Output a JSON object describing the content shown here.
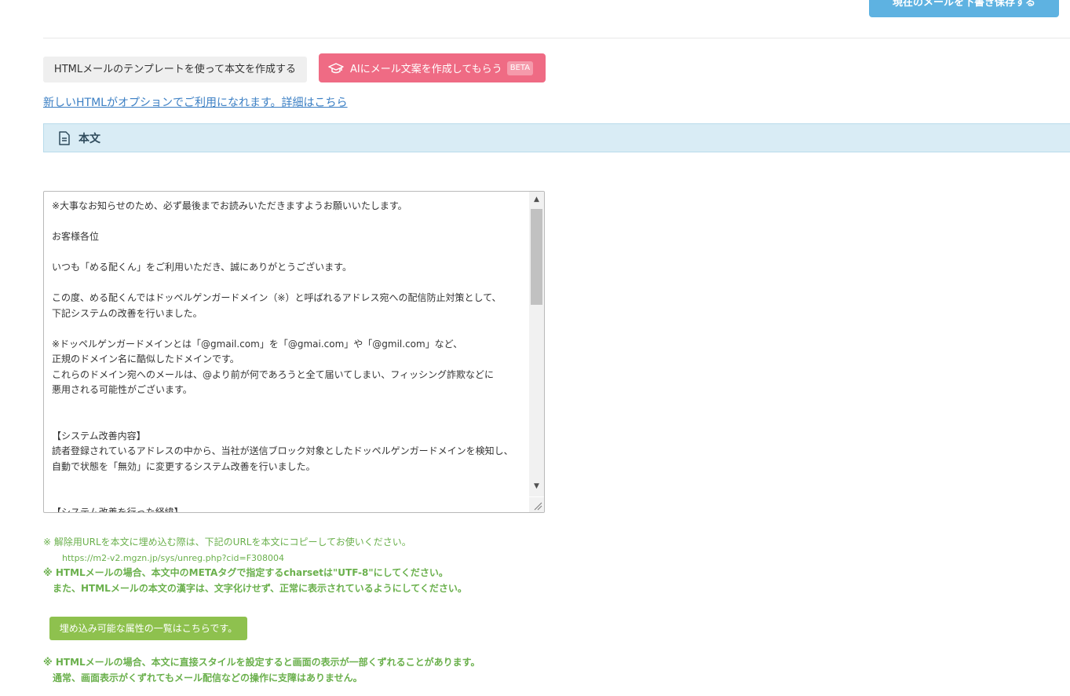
{
  "toolbar": {
    "save_draft_label": "現在のメールを下書き保存する"
  },
  "editor_tools": {
    "template_button_label": "HTMLメールのテンプレートを使って本文を作成する",
    "ai_button_label": "AIにメール文案を作成してもらう",
    "ai_badge": "BETA",
    "html_option_link": "新しいHTMLがオプションでご利用になれます。詳細はこちら"
  },
  "section": {
    "title": "本文",
    "icon": "document-icon"
  },
  "body_text": {
    "value": "※大事なお知らせのため、必ず最後までお読みいただきますようお願いいたします。\n\nお客様各位\n\nいつも「める配くん」をご利用いただき、誠にありがとうございます。\n\nこの度、める配くんではドッペルゲンガードメイン（※）と呼ばれるアドレス宛への配信防止対策として、\n下記システムの改善を行いました。\n\n※ドッペルゲンガードメインとは「@gmail.com」を「@gmai.com」や「@gmil.com」など、\n正規のドメイン名に酷似したドメインです。\nこれらのドメイン宛へのメールは、@より前が何であろうと全て届いてしまい、フィッシング詐欺などに\n悪用される可能性がございます。\n\n\n【システム改善内容】\n読者登録されているアドレスの中から、当社が送信ブロック対象としたドッペルゲンガードメインを検知し、\n自動で状態を「無効」に変更するシステム改善を行いました。\n\n\n【システム改善を行った経緯】"
  },
  "notes": {
    "unsubscribe_note": "※ 解除用URLを本文に埋め込む際は、下記のURLを本文にコピーしてお使いください。",
    "unsubscribe_url": "https://m2-v2.mgzn.jp/sys/unreg.php?cid=F308004",
    "charset_note": "※ HTMLメールの場合、本文中のMETAタグで指定するcharsetは\"UTF-8\"にしてください。",
    "kanji_note": "また、HTMLメールの本文の漢字は、文字化けせず、正常に表示されているようにしてください。",
    "attributes_button_label": "埋め込み可能な属性の一覧はこちらです。",
    "style_note": "※ HTMLメールの場合、本文に直接スタイルを設定すると画面の表示が一部くずれることがあります。",
    "style_note_2": "通常、画面表示がくずれてもメール配信などの操作に支障はありません。"
  },
  "colors": {
    "save_button": "#5eb2e1",
    "ai_button": "#ef6b84",
    "section_header_bg": "#d9ecf5",
    "link": "#3b7fc4",
    "note_text": "#6ab04c",
    "attributes_button": "#8ec14e"
  }
}
